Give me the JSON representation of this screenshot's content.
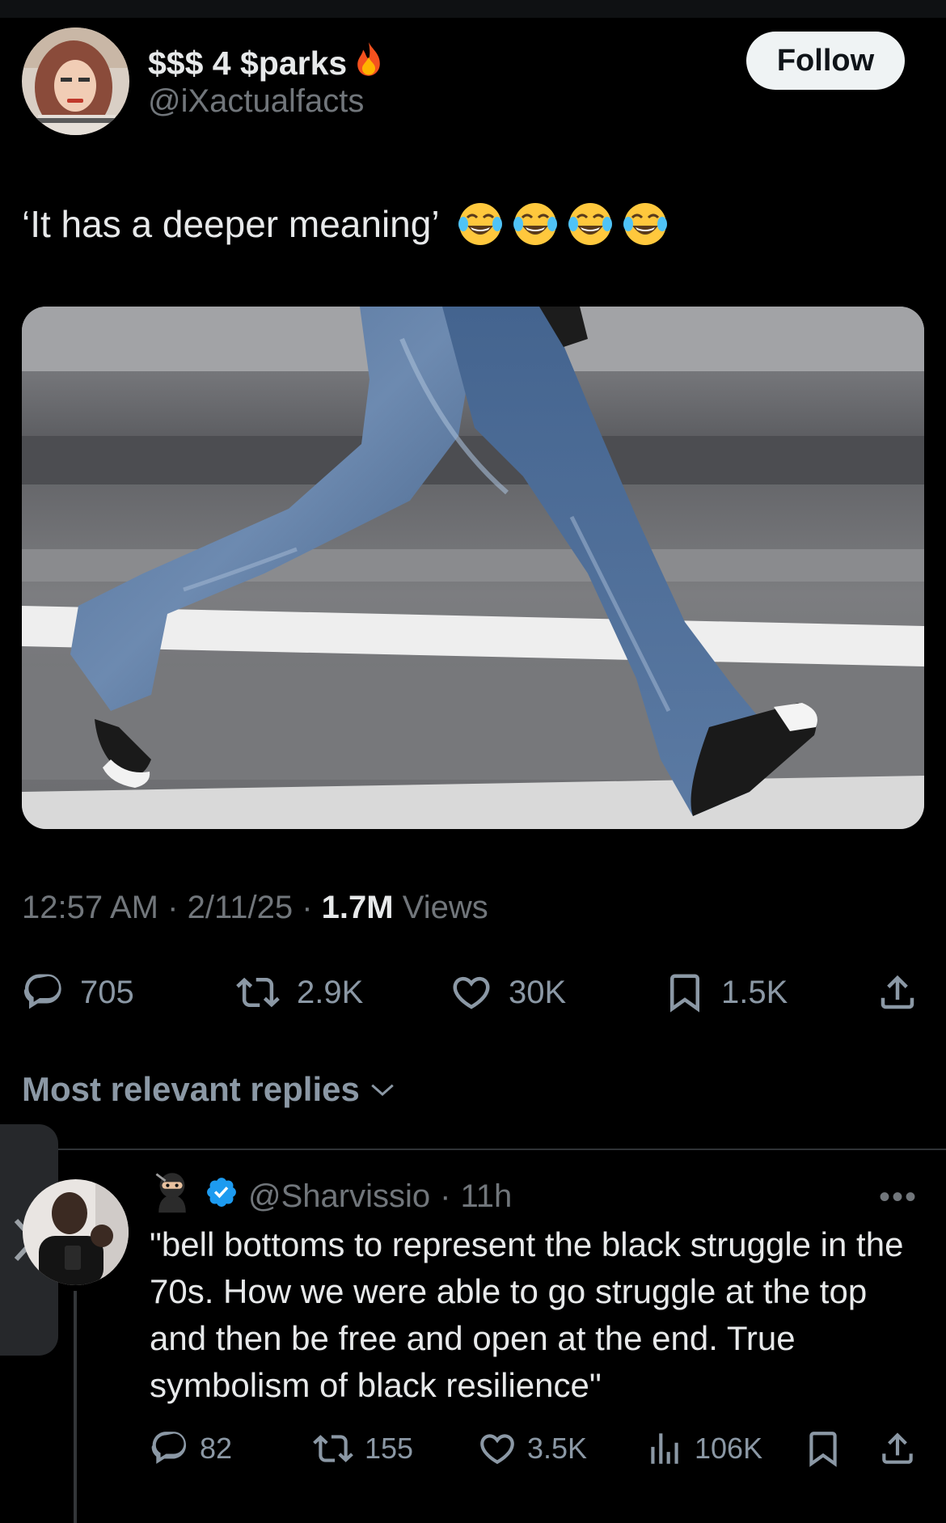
{
  "tweet": {
    "display_name": "$$$ 4 $parks",
    "name_emoji": "fire",
    "handle": "@iXactualfacts",
    "follow_label": "Follow",
    "text": "‘It has a deeper meaning’",
    "text_emojis": [
      "face-with-tears-of-joy",
      "face-with-tears-of-joy",
      "face-with-tears-of-joy",
      "face-with-tears-of-joy"
    ],
    "time": "12:57 AM",
    "date": "2/11/25",
    "views_count": "1.7M",
    "views_label": "Views",
    "separator": "·",
    "stats": {
      "replies": "705",
      "reposts": "2.9K",
      "likes": "30K",
      "bookmarks": "1.5K"
    }
  },
  "replies_sort_label": "Most relevant replies",
  "reply": {
    "name_emoji": "ninja",
    "verified": true,
    "handle": "@Sharvissio",
    "separator": "·",
    "time": "11h",
    "more_label": "•••",
    "text": "\"bell bottoms to represent the black struggle in the 70s. How we were able to go struggle at the top and then be free and open at the end. True symbolism of black resilience\"",
    "stats": {
      "replies": "82",
      "reposts": "155",
      "likes": "3.5K",
      "views": "106K"
    }
  },
  "colors": {
    "background": "#000000",
    "text_primary": "#e7e9ea",
    "text_secondary": "#71767b",
    "icon_gray": "#8b98a5",
    "verified_blue": "#1d9bf0",
    "follow_button_bg": "#eff3f4"
  }
}
